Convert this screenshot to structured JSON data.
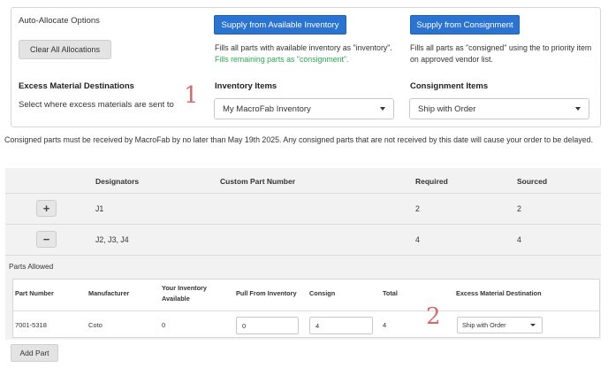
{
  "auto_allocate": {
    "title": "Auto-Allocate Options",
    "clear_button": "Clear All Allocations",
    "excess_title": "Excess Material Destinations",
    "excess_desc": "Select where excess materials are sent to"
  },
  "inventory": {
    "supply_button": "Supply from Available Inventory",
    "desc_line1": "Fills all parts with available inventory as \"inventory\".",
    "desc_line2": "Fills remaining parts as \"consignment\".",
    "items_label": "Inventory Items",
    "select_value": "My MacroFab Inventory"
  },
  "consignment": {
    "supply_button": "Supply from Consignment",
    "desc_line1": "Fills all parts as \"consigned\" using the to priority item",
    "desc_line2": "on approved vendor list.",
    "items_label": "Consignment Items",
    "select_value": "Ship with Order"
  },
  "annotations": {
    "one": "1",
    "two": "2"
  },
  "notice": "Consigned parts must be received by MacroFab by no later than May 19th 2025.  Any consigned parts that are not received by this date will cause your order to be delayed.",
  "table": {
    "headers": {
      "designators": "Designators",
      "custom_part": "Custom Part Number",
      "required": "Required",
      "sourced": "Sourced"
    },
    "rows": [
      {
        "toggle": "+",
        "designators": "J1",
        "required": "2",
        "sourced": "2"
      },
      {
        "toggle": "−",
        "designators": "J2, J3, J4",
        "required": "4",
        "sourced": "4"
      }
    ],
    "parts_allowed_label": "Parts Allowed",
    "parts": {
      "headers": {
        "part_number": "Part Number",
        "manufacturer": "Manufacturer",
        "your_inventory": "Your Inventory Available",
        "pull_from_inventory": "Pull From Inventory",
        "consign": "Consign",
        "total": "Total",
        "excess_destination": "Excess Material Destination"
      },
      "row": {
        "part_number": "7001-5318",
        "manufacturer": "Coto",
        "your_inventory": "0",
        "pull_from_inventory": "0",
        "consign": "4",
        "total": "4",
        "excess_destination": "Ship with Order"
      }
    },
    "add_part_button": "Add Part"
  },
  "colors": {
    "accent_blue": "#2a73d0",
    "annotation_red": "#d36b6b",
    "green_text": "#2aa84a"
  }
}
